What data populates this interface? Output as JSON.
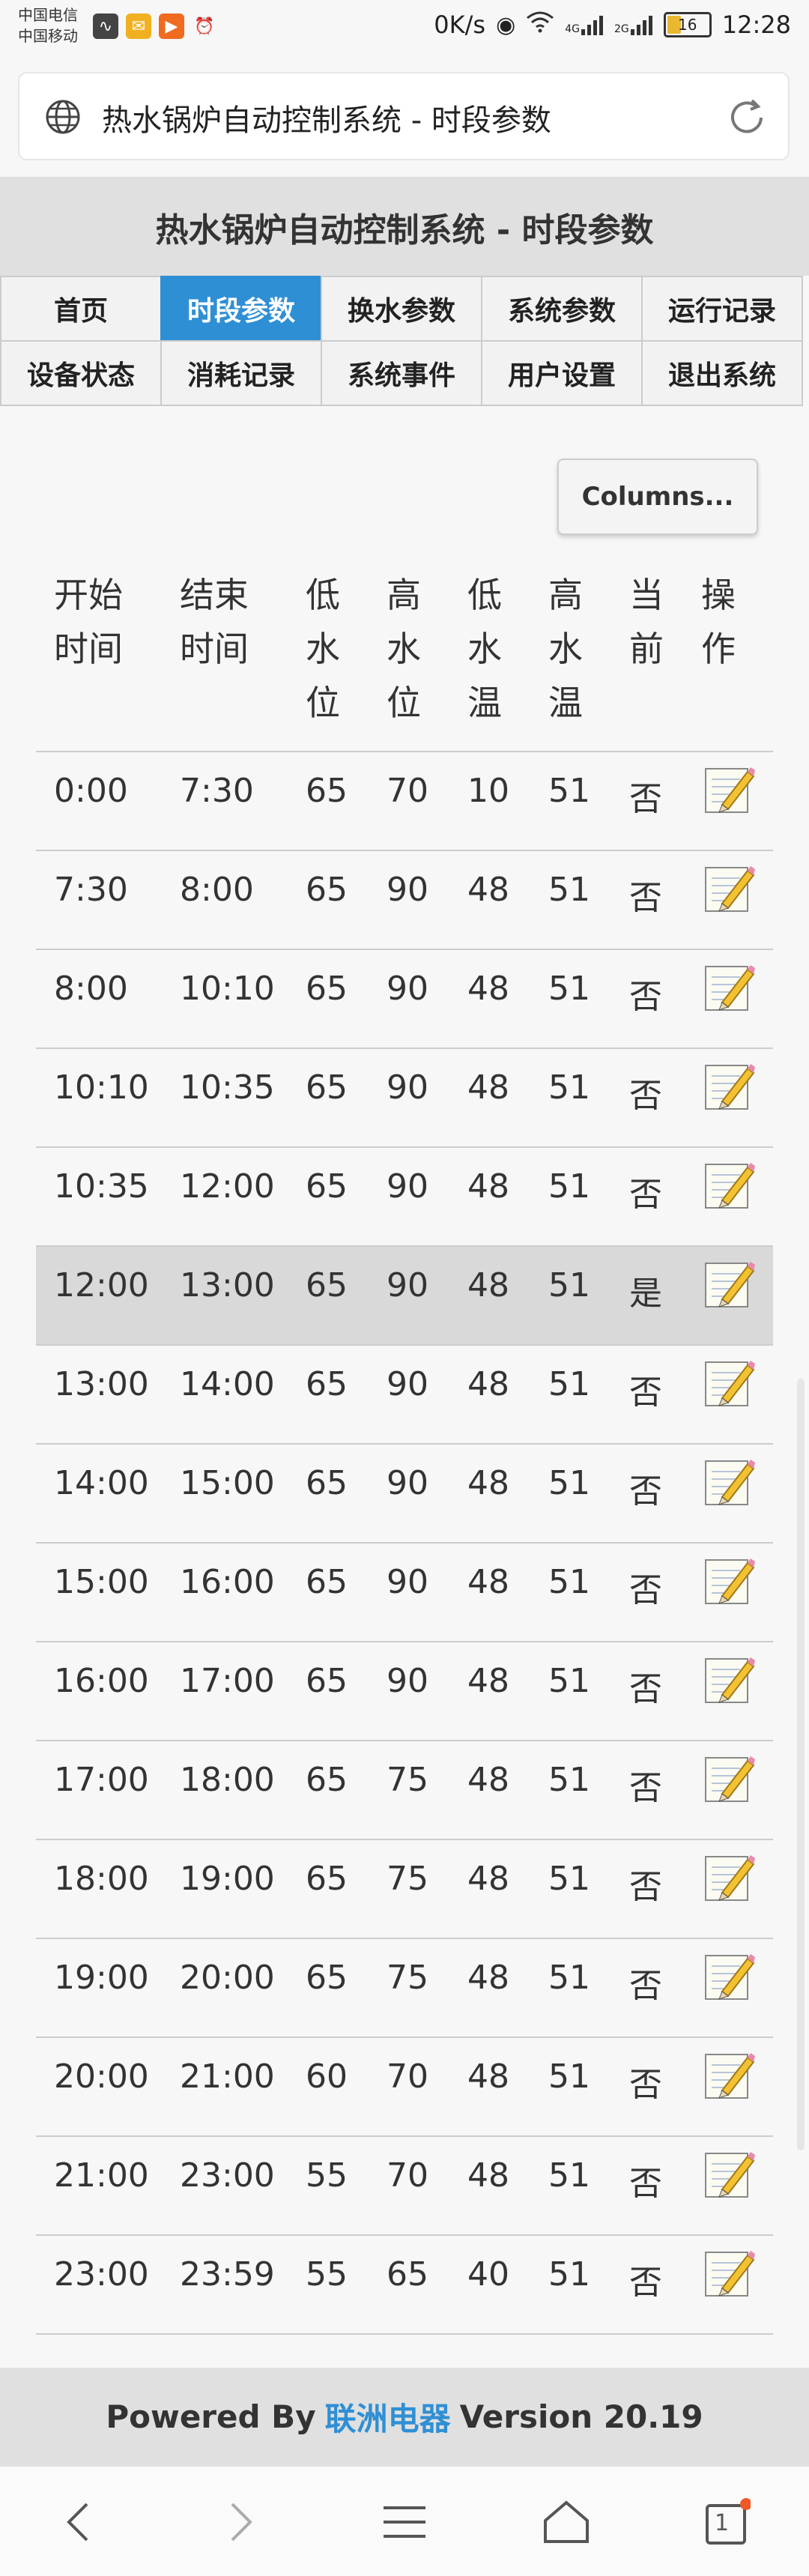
{
  "status_bar": {
    "carrier1": "中国电信",
    "carrier2": "中国移动",
    "speed": "0K/s",
    "network1": "4G",
    "network2": "2G",
    "battery": "16",
    "time": "12:28"
  },
  "address_bar": {
    "title": "热水锅炉自动控制系统 - 时段参数"
  },
  "header": {
    "title": "热水锅炉自动控制系统 - 时段参数"
  },
  "nav": {
    "items": [
      {
        "label": "首页"
      },
      {
        "label": "时段参数",
        "active": true
      },
      {
        "label": "换水参数"
      },
      {
        "label": "系统参数"
      },
      {
        "label": "运行记录"
      },
      {
        "label": "设备状态"
      },
      {
        "label": "消耗记录"
      },
      {
        "label": "系统事件"
      },
      {
        "label": "用户设置"
      },
      {
        "label": "退出系统"
      }
    ]
  },
  "columns_button": "Columns...",
  "table": {
    "headers": [
      [
        "开始",
        "时间"
      ],
      [
        "结束",
        "时间"
      ],
      [
        "低",
        "水",
        "位"
      ],
      [
        "高",
        "水",
        "位"
      ],
      [
        "低",
        "水",
        "温"
      ],
      [
        "高",
        "水",
        "温"
      ],
      [
        "当",
        "前"
      ],
      [
        "操",
        "作"
      ]
    ],
    "rows": [
      [
        "0:00",
        "7:30",
        "65",
        "70",
        "10",
        "51",
        "否"
      ],
      [
        "7:30",
        "8:00",
        "65",
        "90",
        "48",
        "51",
        "否"
      ],
      [
        "8:00",
        "10:10",
        "65",
        "90",
        "48",
        "51",
        "否"
      ],
      [
        "10:10",
        "10:35",
        "65",
        "90",
        "48",
        "51",
        "否"
      ],
      [
        "10:35",
        "12:00",
        "65",
        "90",
        "48",
        "51",
        "否"
      ],
      [
        "12:00",
        "13:00",
        "65",
        "90",
        "48",
        "51",
        "是"
      ],
      [
        "13:00",
        "14:00",
        "65",
        "90",
        "48",
        "51",
        "否"
      ],
      [
        "14:00",
        "15:00",
        "65",
        "90",
        "48",
        "51",
        "否"
      ],
      [
        "15:00",
        "16:00",
        "65",
        "90",
        "48",
        "51",
        "否"
      ],
      [
        "16:00",
        "17:00",
        "65",
        "90",
        "48",
        "51",
        "否"
      ],
      [
        "17:00",
        "18:00",
        "65",
        "75",
        "48",
        "51",
        "否"
      ],
      [
        "18:00",
        "19:00",
        "65",
        "75",
        "48",
        "51",
        "否"
      ],
      [
        "19:00",
        "20:00",
        "65",
        "75",
        "48",
        "51",
        "否"
      ],
      [
        "20:00",
        "21:00",
        "60",
        "70",
        "48",
        "51",
        "否"
      ],
      [
        "21:00",
        "23:00",
        "55",
        "70",
        "48",
        "51",
        "否"
      ],
      [
        "23:00",
        "23:59",
        "55",
        "65",
        "40",
        "51",
        "否"
      ]
    ]
  },
  "footer": {
    "prefix": "Powered By",
    "brand": "联洲电器",
    "suffix": "Version 20.19",
    "brand_color": "#2f8fd4"
  },
  "bottom_nav": {
    "tab_count": "1"
  },
  "colors": {
    "accent": "#2f8fd4",
    "header_bg": "#e0e0e0",
    "current_row_bg": "#d9d9d9"
  }
}
